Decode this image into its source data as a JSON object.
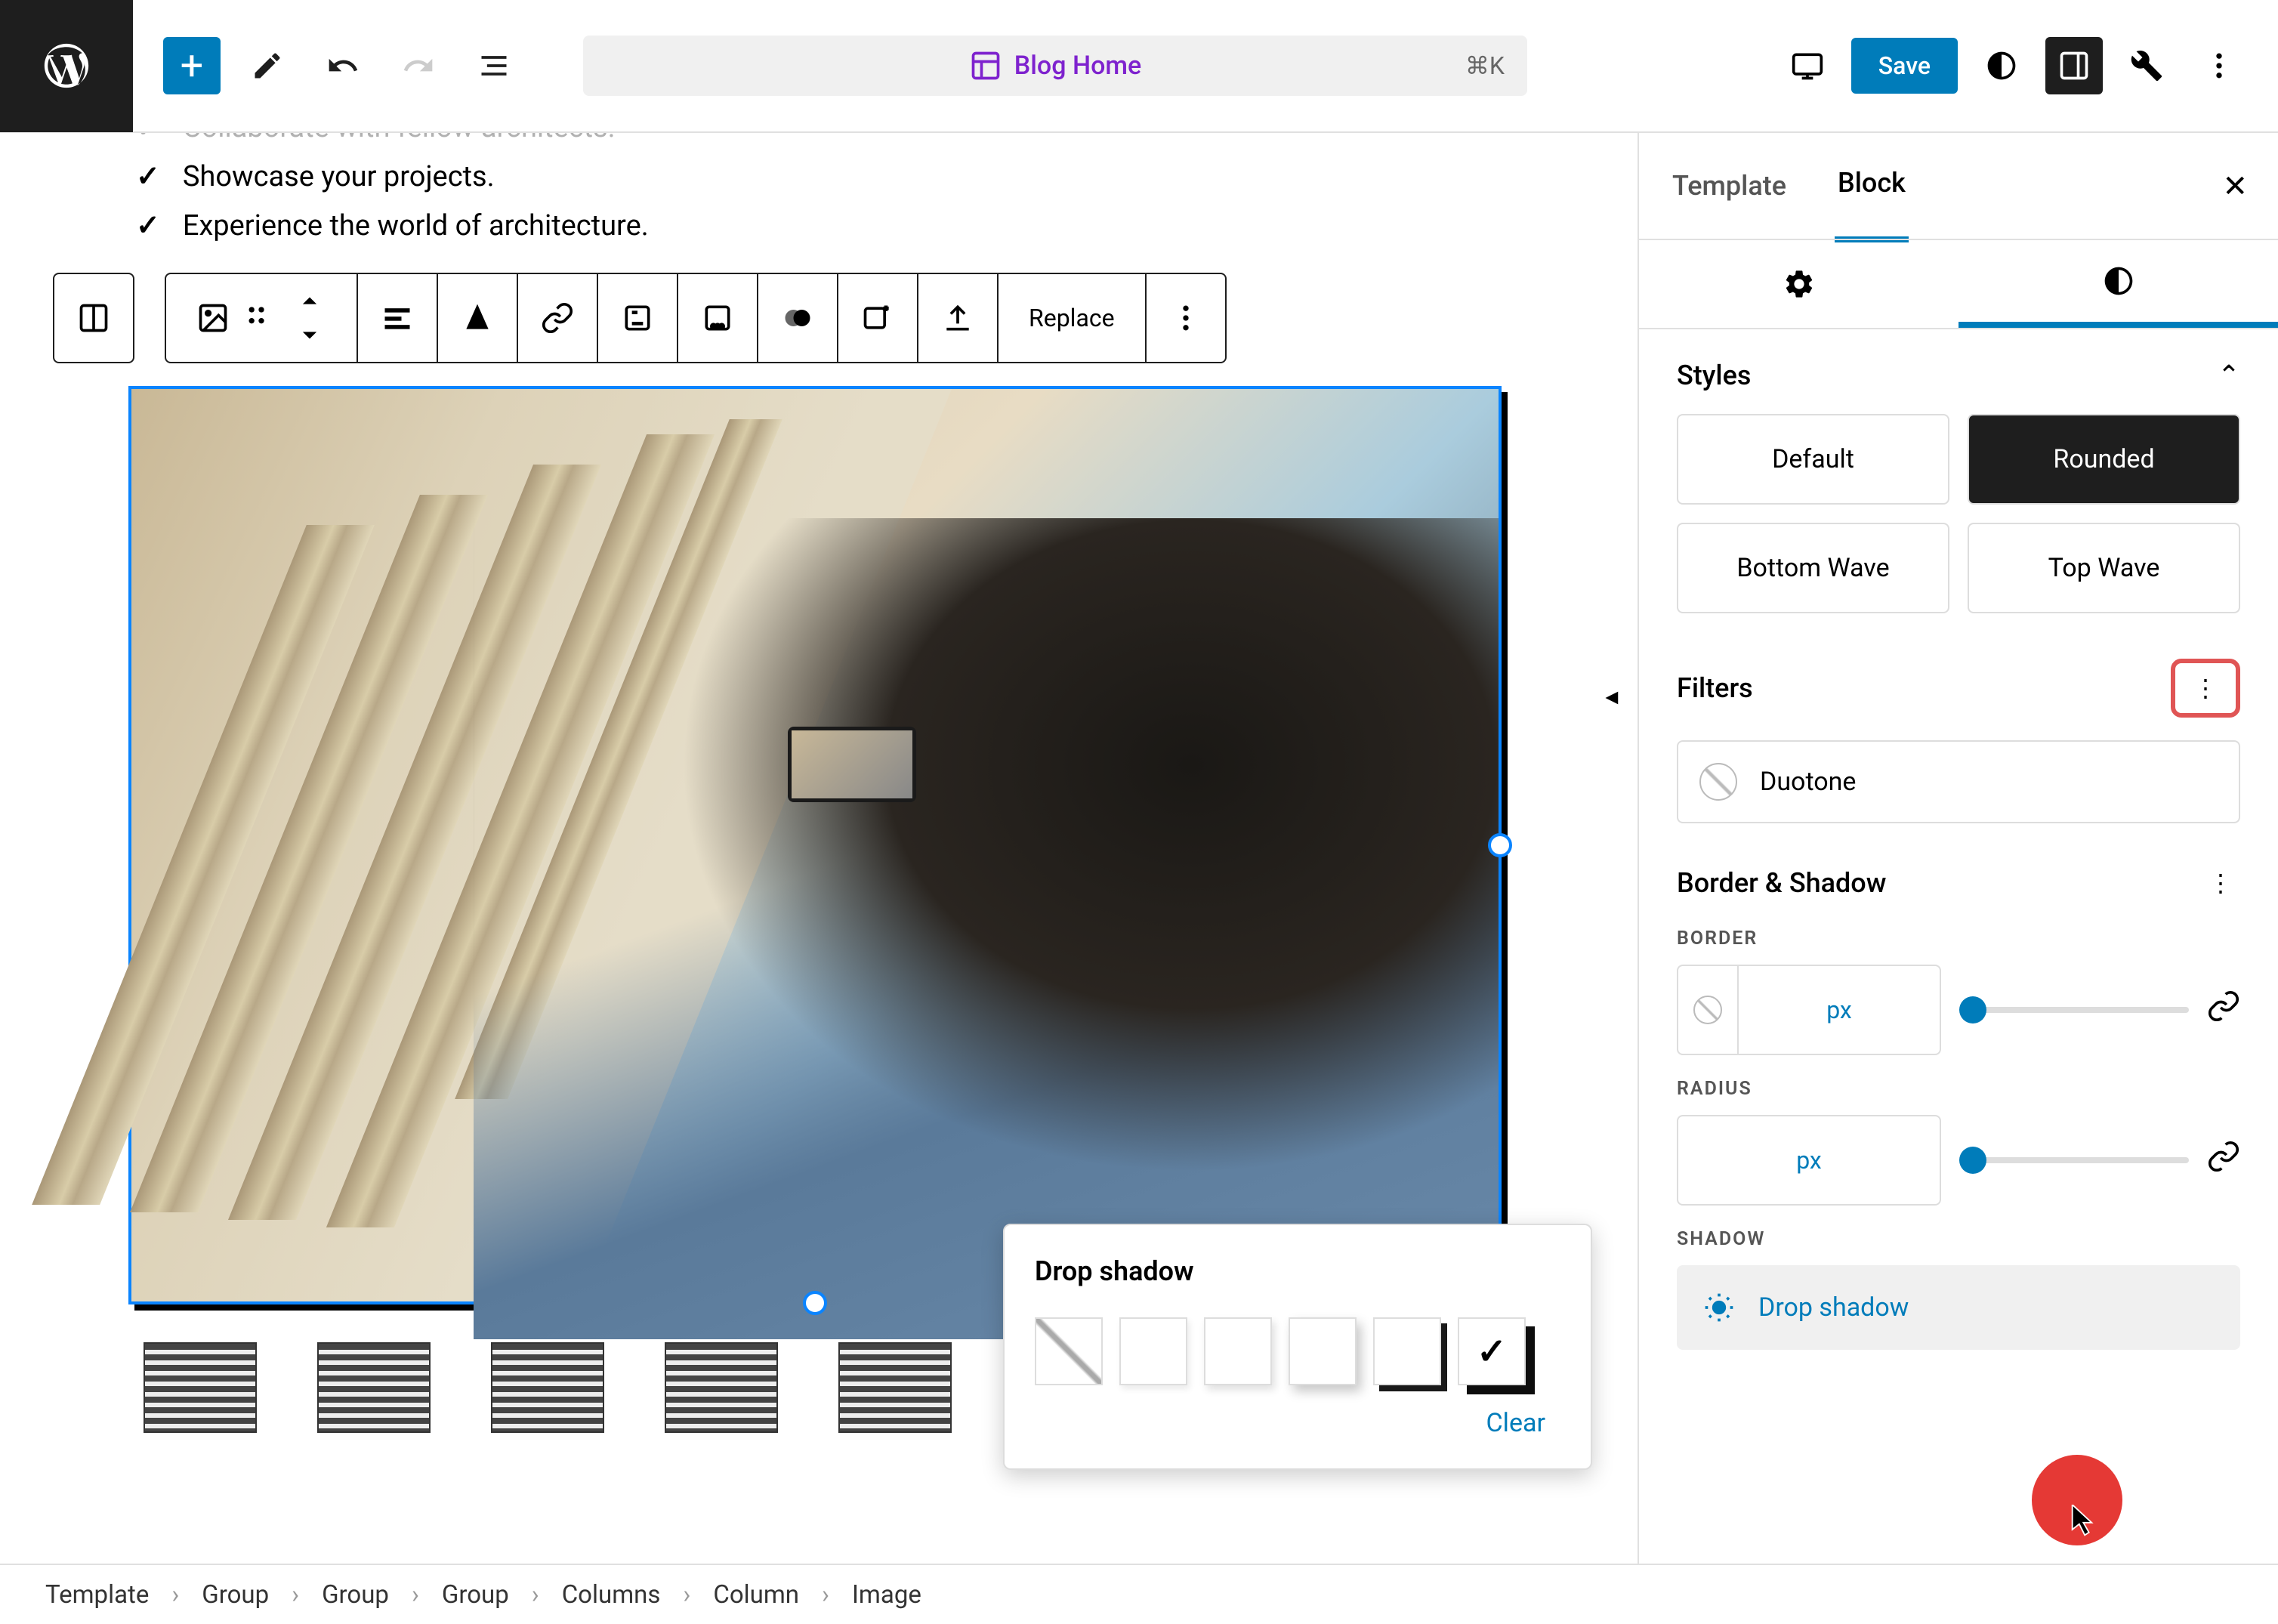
{
  "topbar": {
    "doc_title": "Blog Home",
    "shortcut": "⌘K",
    "save": "Save"
  },
  "list": {
    "item1": "Collaborate with fellow architects.",
    "item2": "Showcase your projects.",
    "item3": "Experience the world of architecture."
  },
  "block_toolbar": {
    "replace": "Replace"
  },
  "popover": {
    "title": "Drop shadow",
    "clear": "Clear"
  },
  "sidebar": {
    "tab_template": "Template",
    "tab_block": "Block",
    "styles": {
      "title": "Styles",
      "default": "Default",
      "rounded": "Rounded",
      "bottom_wave": "Bottom Wave",
      "top_wave": "Top Wave"
    },
    "filters": {
      "title": "Filters",
      "duotone": "Duotone"
    },
    "border_shadow": {
      "title": "Border & Shadow",
      "border": "BORDER",
      "radius": "RADIUS",
      "shadow": "SHADOW",
      "px": "px",
      "drop_shadow": "Drop shadow"
    }
  },
  "breadcrumb": {
    "template": "Template",
    "group1": "Group",
    "group2": "Group",
    "group3": "Group",
    "columns": "Columns",
    "column": "Column",
    "image": "Image"
  }
}
